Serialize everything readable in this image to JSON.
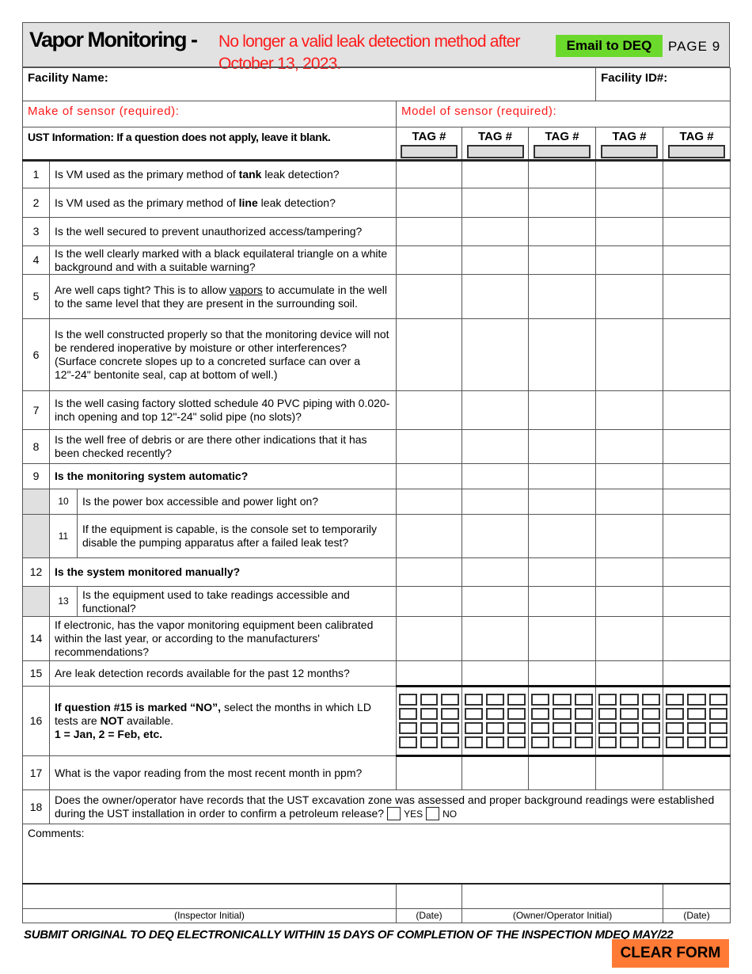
{
  "header": {
    "title": "Vapor Monitoring - ",
    "warning": "No longer a valid leak detection method after October 13, 2023.",
    "email_button": "Email to DEQ",
    "page": "PAGE 9",
    "email_color": "#6bd92c"
  },
  "facility": {
    "name_label": "Facility Name:",
    "id_label": "Facility ID#:"
  },
  "sensor": {
    "make_label": "Make of sensor (required):",
    "model_label": "Model of sensor (required):"
  },
  "ust": {
    "instruction": "UST Information: If a question does not apply, leave it blank.",
    "tag_label": "TAG #",
    "tag_count": 5
  },
  "questions": [
    {
      "n": "1",
      "sub": false,
      "text": [
        {
          "t": "Is VM used as the primary method of "
        },
        {
          "t": "tank",
          "b": true
        },
        {
          "t": " leak detection?"
        }
      ]
    },
    {
      "n": "2",
      "sub": false,
      "text": [
        {
          "t": "Is VM used as the primary method of "
        },
        {
          "t": "line",
          "b": true
        },
        {
          "t": " leak detection?"
        }
      ]
    },
    {
      "n": "3",
      "sub": false,
      "text": [
        {
          "t": "Is the well secured to prevent unauthorized access/tampering?"
        }
      ]
    },
    {
      "n": "4",
      "sub": false,
      "text": [
        {
          "t": "Is the well clearly marked with a black equilateral triangle on a white background and with a suitable warning?"
        }
      ]
    },
    {
      "n": "5",
      "sub": false,
      "text": [
        {
          "t": "Are well caps tight?  This is to allow "
        },
        {
          "t": "vapors",
          "u": true
        },
        {
          "t": " to accumulate in the well to the same level that they are present in the surrounding soil."
        }
      ]
    },
    {
      "n": "6",
      "sub": false,
      "text": [
        {
          "t": "Is the well constructed properly so that the monitoring device will not be rendered inoperative by moisture or other interferences? (Surface concrete slopes up to a concreted surface can over a 12\"-24\" bentonite seal, cap at bottom of well.)"
        }
      ]
    },
    {
      "n": "7",
      "sub": false,
      "text": [
        {
          "t": "Is the well casing factory slotted schedule 40 PVC piping with 0.020-inch opening and top 12\"-24\" solid pipe (no slots)?"
        }
      ]
    },
    {
      "n": "8",
      "sub": false,
      "text": [
        {
          "t": "Is the well free of debris or are there other indications that it has been checked recently?"
        }
      ]
    },
    {
      "n": "9",
      "sub": false,
      "text": [
        {
          "t": "Is the monitoring system automatic?",
          "b": true
        }
      ]
    },
    {
      "n": "10",
      "sub": true,
      "text": [
        {
          "t": "Is the power box accessible and power light on?"
        }
      ]
    },
    {
      "n": "11",
      "sub": true,
      "text": [
        {
          "t": "If the equipment is capable, is the console set to temporarily disable the pumping apparatus after a failed leak test?"
        }
      ]
    },
    {
      "n": "12",
      "sub": false,
      "text": [
        {
          "t": "Is the system monitored manually?",
          "b": true
        }
      ]
    },
    {
      "n": "13",
      "sub": true,
      "text": [
        {
          "t": "Is the equipment used to take readings accessible and functional?"
        }
      ]
    },
    {
      "n": "14",
      "sub": false,
      "text": [
        {
          "t": "If electronic, has the vapor monitoring equipment been calibrated within the last year, or according to the manufacturers' recommendations?"
        }
      ]
    },
    {
      "n": "15",
      "sub": false,
      "text": [
        {
          "t": "Are leak detection records available for the past 12 months?"
        }
      ]
    },
    {
      "n": "16",
      "sub": false,
      "months": true,
      "text": [
        {
          "t": "If question #15 is marked “NO”,",
          "b": true
        },
        {
          "t": " select the months in which LD tests are "
        },
        {
          "t": "NOT",
          "b": true
        },
        {
          "t": " available."
        },
        {
          "t": "\n"
        },
        {
          "t": "1 = Jan, 2 = Feb, etc.",
          "b": true
        }
      ]
    },
    {
      "n": "17",
      "sub": false,
      "text": [
        {
          "t": "What is the vapor reading from the most recent month in ppm?"
        }
      ]
    }
  ],
  "q18": {
    "n": "18",
    "text": "Does the owner/operator have records that the UST excavation zone was assessed and proper background readings were established during the UST installation in order to confirm a petroleum release?",
    "yes": "YES",
    "no": "NO"
  },
  "comments_label": "Comments:",
  "signatures": {
    "inspector": "(Inspector Initial)",
    "date1": "(Date)",
    "owner": "(Owner/Operator Initial)",
    "date2": "(Date)"
  },
  "footer": "SUBMIT ORIGINAL TO DEQ ELECTRONICALLY WITHIN 15 DAYS OF COMPLETION OF THE INSPECTION    MDEQ MAY/22",
  "clear_button": "CLEAR FORM",
  "clear_color": "#ff7a35"
}
